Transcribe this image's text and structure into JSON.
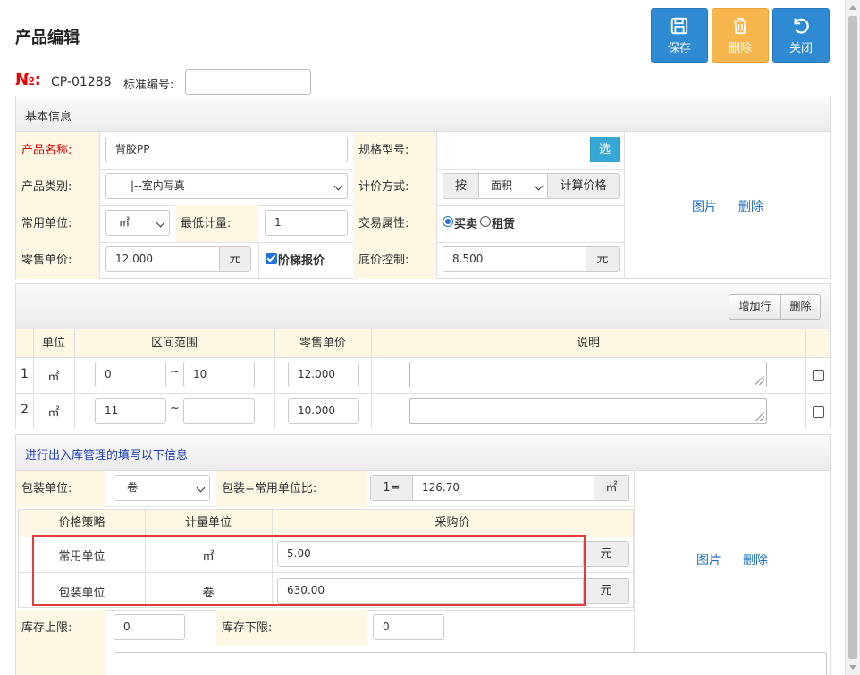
{
  "header": {
    "title": "产品编辑"
  },
  "toolbar": {
    "save": "保存",
    "delete": "删除",
    "close": "关闭"
  },
  "product_no": {
    "label": "№:",
    "value": "CP-01288",
    "std_label": "标准编号:",
    "std_value": ""
  },
  "basic": {
    "heading": "基本信息",
    "name_label": "产品名称:",
    "name_value": "背胶PP",
    "spec_label": "规格型号:",
    "spec_value": "",
    "spec_pick": "选",
    "category_label": "产品类别:",
    "category_value": "|--室内写真",
    "pricing_label": "计价方式:",
    "pricing_prefix": "按",
    "pricing_value": "面积",
    "pricing_calc": "计算价格",
    "unit_label": "常用单位:",
    "unit_value": "㎡",
    "min_qty_label": "最低计量:",
    "min_qty_value": "1",
    "trade_label": "交易属性:",
    "trade_options": [
      "买卖",
      "租赁"
    ],
    "trade_selected": "买卖",
    "retail_label": "零售单价:",
    "retail_value": "12.000",
    "retail_unit": "元",
    "tier_label": "阶梯报价",
    "tier_checked": true,
    "floor_label": "底价控制:",
    "floor_value": "8.500",
    "floor_unit": "元",
    "image_link": "图片",
    "image_delete": "删除"
  },
  "tier_table": {
    "add_row": "增加行",
    "delete": "删除",
    "headers": [
      "单位",
      "区间范围",
      "零售单价",
      "说明"
    ],
    "range_sep": "~",
    "rows": [
      {
        "index": "1",
        "unit": "㎡",
        "from": "0",
        "to": "10",
        "price": "12.000",
        "note": ""
      },
      {
        "index": "2",
        "unit": "㎡",
        "from": "11",
        "to": "",
        "price": "10.000",
        "note": ""
      }
    ]
  },
  "stock": {
    "note": "进行出入库管理的填写以下信息",
    "pack_unit_label": "包装单位:",
    "pack_unit_value": "卷",
    "ratio_label": "包装=常用单位比:",
    "ratio_prefix": "1=",
    "ratio_value": "126.70",
    "ratio_unit": "㎡",
    "headers": [
      "价格策略",
      "计量单位",
      "采购价"
    ],
    "rows": [
      {
        "strategy": "常用单位",
        "unit": "㎡",
        "price": "5.00",
        "currency": "元"
      },
      {
        "strategy": "包装单位",
        "unit": "卷",
        "price": "630.00",
        "currency": "元"
      }
    ],
    "image_link": "图片",
    "image_delete": "删除",
    "max_label": "库存上限:",
    "max_value": "0",
    "min_label": "库存下限:",
    "min_value": "0"
  },
  "colors": {
    "primary": "#2e8ad3",
    "warning": "#f7b64d",
    "label_bg": "#fdf7e4",
    "highlight": "#e23b3b"
  }
}
